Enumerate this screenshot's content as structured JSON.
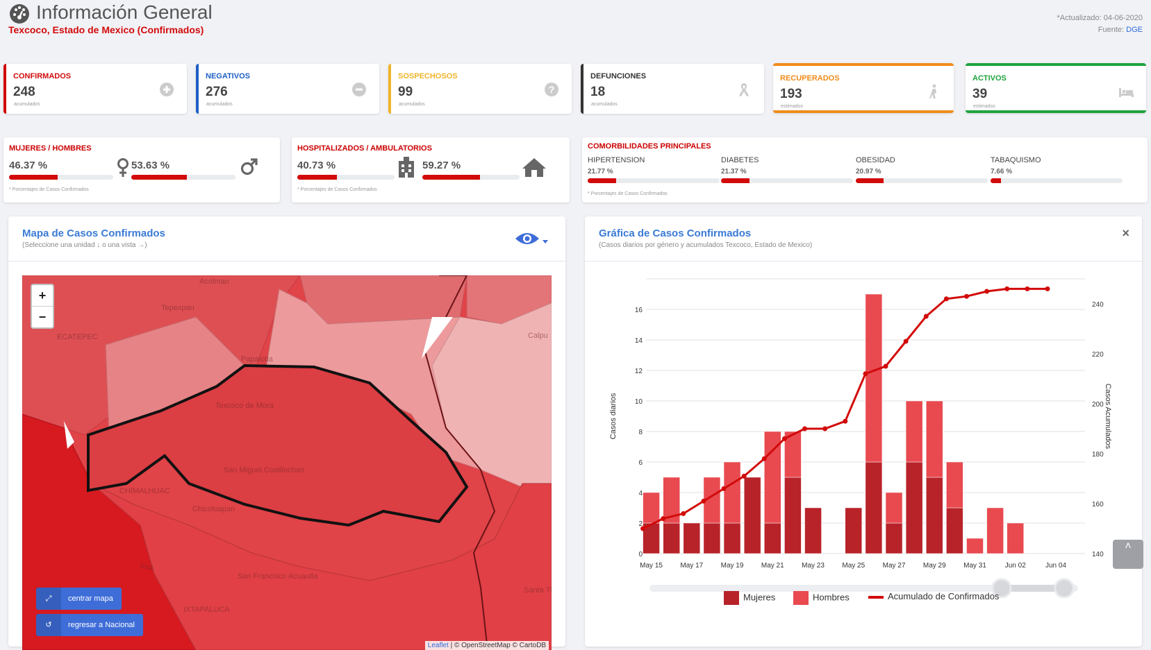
{
  "header": {
    "title": "Información General",
    "subtitle": "Texcoco, Estado de Mexico (Confirmados)",
    "updated": "*Actualizado: 04-06-2020",
    "source_label": "Fuente:",
    "source_value": "DGE"
  },
  "stats": [
    {
      "label": "CONFIRMADOS",
      "value": "248",
      "note": "acumulados",
      "color": "#d20a0a",
      "icon": "plus-circle-icon"
    },
    {
      "label": "NEGATIVOS",
      "value": "276",
      "note": "acumulados",
      "color": "#1d5fc5",
      "icon": "minus-circle-icon"
    },
    {
      "label": "SOSPECHOSOS",
      "value": "99",
      "note": "acumulados",
      "color": "#f0b429",
      "icon": "question-circle-icon"
    },
    {
      "label": "DEFUNCIONES",
      "value": "18",
      "note": "acumulados",
      "color": "#333333",
      "icon": "ribbon-icon"
    },
    {
      "label": "RECUPERADOS",
      "value": "193",
      "note": "estimados",
      "color": "#f08c1a",
      "icon": "walking-icon"
    },
    {
      "label": "ACTIVOS",
      "value": "39",
      "note": "estimados",
      "color": "#1fa33c",
      "icon": "bed-icon"
    }
  ],
  "gender": {
    "label": "MUJERES / HOMBRES",
    "mujeres": "46.37 %",
    "mujeres_pct": 46.37,
    "hombres": "53.63 %",
    "hombres_pct": 53.63,
    "note": "* Porcentajes  de Casos Confirmados"
  },
  "hosp": {
    "label": "HOSPITALIZADOS / AMBULATORIOS",
    "hosp": "40.73 %",
    "hosp_pct": 40.73,
    "amb": "59.27 %",
    "amb_pct": 59.27,
    "note": "* Porcentajes  de Casos Confirmados"
  },
  "comorb": {
    "label": "COMORBILIDADES PRINCIPALES",
    "items": [
      {
        "name": "HIPERTENSION",
        "value": "21.77 %",
        "pct": 21.77
      },
      {
        "name": "DIABETES",
        "value": "21.37 %",
        "pct": 21.37
      },
      {
        "name": "OBESIDAD",
        "value": "20.97 %",
        "pct": 20.97
      },
      {
        "name": "TABAQUISMO",
        "value": "7.66 %",
        "pct": 7.66
      }
    ],
    "note": "* Porcentajes  de Casos Confirmados"
  },
  "map_panel": {
    "title": "Mapa de Casos Confirmados",
    "subtitle": "(Seleccione una unidad ↓ o una vista →)",
    "zoom_in": "+",
    "zoom_out": "−",
    "center_btn": "centrar mapa",
    "national_btn": "regresar a Nacional",
    "attribution_leaflet": "Leaflet",
    "attribution_rest": " | © OpenStreetMap © CartoDB",
    "places": [
      "Acolman",
      "Tepexpan",
      "ECATEPEC",
      "Papalotla",
      "Texcoco de Mora",
      "San Miguel Coatlinchan",
      "CHIMALHUAC",
      "Chicoloapan",
      "San Francisco Acuautla",
      "IXTAPALUCA",
      "Santa Tlahua",
      "Calpu",
      "Paz"
    ]
  },
  "chart_panel": {
    "title": "Gráfica de Casos Confirmados",
    "subtitle": "(Casos diarios por género y acumulados Texcoco, Estado de Mexico)",
    "close": "×",
    "legend": [
      "Mujeres",
      "Hombres",
      "Acumulado de Confirmados"
    ]
  },
  "chart_data": {
    "type": "bar",
    "categories": [
      "May 15",
      "May 16",
      "May 17",
      "May 18",
      "May 19",
      "May 20",
      "May 21",
      "May 22",
      "May 23",
      "May 24",
      "May 25",
      "May 26",
      "May 27",
      "May 28",
      "May 29",
      "May 30",
      "May 31",
      "Jun 01",
      "Jun 02",
      "Jun 03",
      "Jun 04"
    ],
    "x_tick_labels": [
      "May 15",
      "May 17",
      "May 19",
      "May 21",
      "May 23",
      "May 25",
      "May 27",
      "May 29",
      "May 31",
      "Jun 02",
      "Jun 04"
    ],
    "series": [
      {
        "name": "Mujeres",
        "type": "bar",
        "stack": "casos",
        "axis": "left",
        "color": "#b8232a",
        "values": [
          2,
          2,
          2,
          2,
          2,
          5,
          2,
          5,
          3,
          0,
          3,
          6,
          2,
          6,
          5,
          3,
          0,
          0,
          0,
          0,
          0
        ]
      },
      {
        "name": "Hombres",
        "type": "bar",
        "stack": "casos",
        "axis": "left",
        "color": "#e84a50",
        "values": [
          2,
          3,
          0,
          3,
          4,
          0,
          6,
          3,
          0,
          0,
          0,
          11,
          2,
          4,
          5,
          3,
          1,
          3,
          2,
          0,
          0
        ]
      },
      {
        "name": "Acumulado de Confirmados",
        "type": "line",
        "axis": "right",
        "color": "#d20a0a",
        "values": [
          150,
          154,
          156,
          161,
          166,
          171,
          178,
          186,
          190,
          190,
          193,
          212,
          215,
          225,
          235,
          242,
          243,
          245,
          246,
          246,
          246
        ]
      }
    ],
    "ylabel": "Casos diarios",
    "y2label": "Casos Acumulados",
    "ylim": [
      0,
      18
    ],
    "yticks": [
      0,
      2,
      4,
      6,
      8,
      10,
      12,
      14,
      16
    ],
    "y2lim": [
      140,
      250
    ],
    "y2ticks": [
      140,
      160,
      180,
      200,
      220,
      240
    ],
    "grid": true,
    "legend_position": "bottom"
  }
}
